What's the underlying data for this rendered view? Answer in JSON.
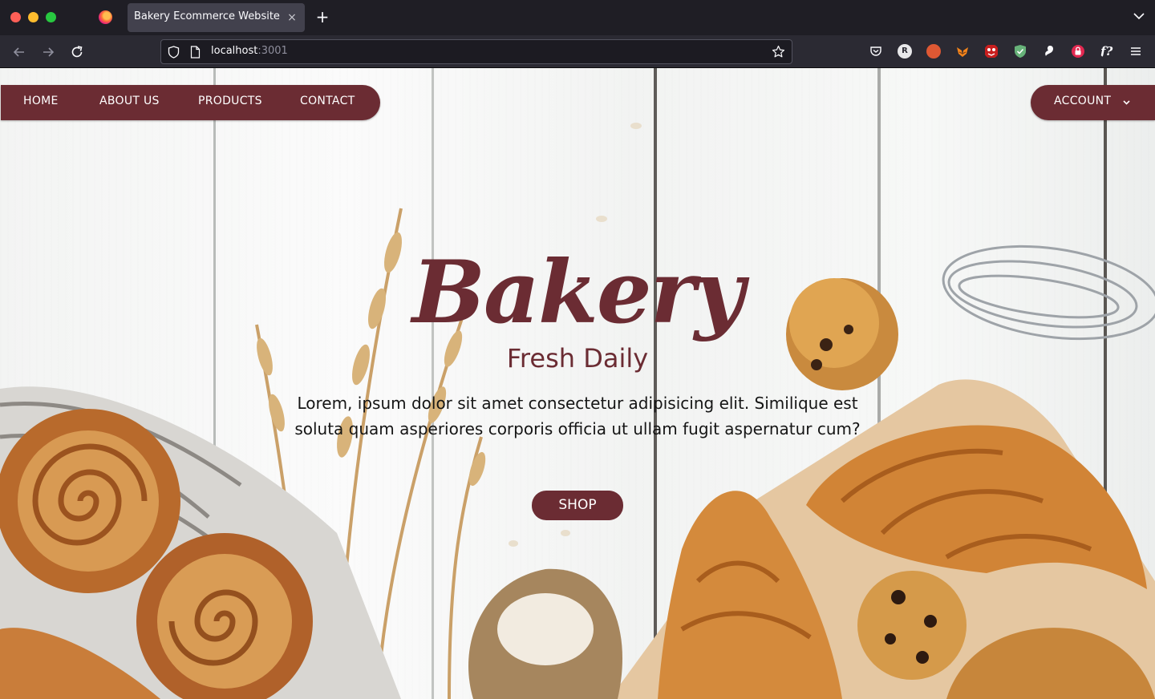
{
  "browser": {
    "tab_title": "Bakery Ecommerce Website",
    "tab_close": "×",
    "new_tab": "+",
    "url_host": "localhost",
    "url_port": ":3001"
  },
  "nav": {
    "links": [
      "HOME",
      "ABOUT US",
      "PRODUCTS",
      "CONTACT"
    ],
    "account": "ACCOUNT"
  },
  "hero": {
    "title": "Bakery",
    "subtitle": "Fresh Daily",
    "description": "Lorem, ipsum dolor sit amet consectetur adipisicing elit. Similique est soluta quam asperiores corporis officia ut ullam fugit aspernatur cum?",
    "shop_label": "SHOP"
  },
  "colors": {
    "brand": "#6b2c33",
    "chrome_bg": "#1f1e25",
    "toolbar_bg": "#2b2a33"
  },
  "icons": {
    "toolbar": [
      "back-icon",
      "forward-icon",
      "reload-icon"
    ],
    "extensions": [
      "pocket-icon",
      "readwise-icon",
      "duckduckgo-icon",
      "metamask-icon",
      "ublock-icon",
      "adguard-icon",
      "gnome-icon",
      "lock-icon",
      "function-icon",
      "menu-icon"
    ]
  }
}
